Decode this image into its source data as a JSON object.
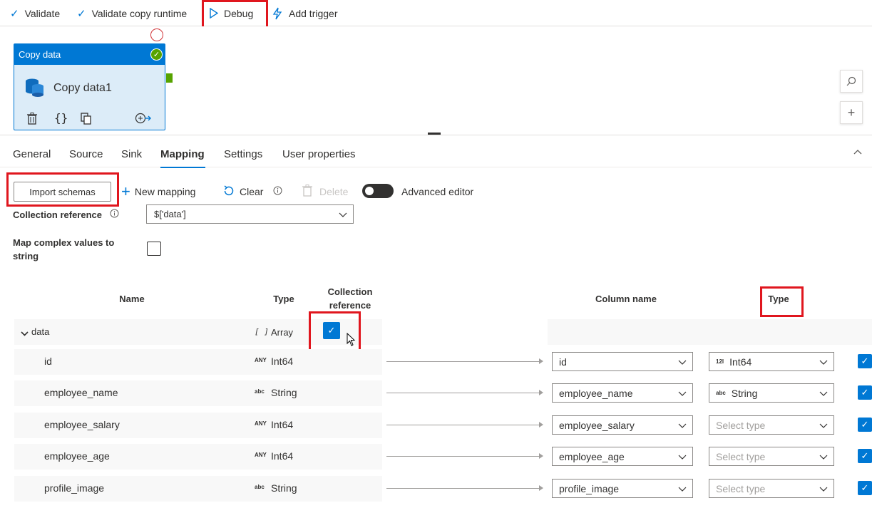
{
  "toolbar": {
    "validate": "Validate",
    "validate_copy_runtime": "Validate copy runtime",
    "debug": "Debug",
    "add_trigger": "Add trigger"
  },
  "activity": {
    "header": "Copy data",
    "name": "Copy data1",
    "status_color": "#57a300"
  },
  "tabs": [
    "General",
    "Source",
    "Sink",
    "Mapping",
    "Settings",
    "User properties"
  ],
  "active_tab": "Mapping",
  "actions": {
    "import_schemas": "Import schemas",
    "new_mapping": "New mapping",
    "clear": "Clear",
    "delete": "Delete",
    "advanced_editor": "Advanced editor"
  },
  "form": {
    "collection_reference_label": "Collection reference",
    "collection_reference_value": "$['data']",
    "map_complex_label_line1": "Map complex values to",
    "map_complex_label_line2": "string"
  },
  "table": {
    "headers": {
      "name": "Name",
      "type": "Type",
      "collection_ref_line1": "Collection",
      "collection_ref_line2": "reference",
      "column_name": "Column name",
      "sink_type": "Type"
    },
    "root": {
      "name": "data",
      "type_badge": "[ ]",
      "type": "Array"
    },
    "rows": [
      {
        "name": "id",
        "badge": "ANY",
        "type": "Int64",
        "column": "id",
        "sink_badge": "12l",
        "sink_type": "Int64"
      },
      {
        "name": "employee_name",
        "badge": "abc",
        "type": "String",
        "column": "employee_name",
        "sink_badge": "abc",
        "sink_type": "String"
      },
      {
        "name": "employee_salary",
        "badge": "ANY",
        "type": "Int64",
        "column": "employee_salary",
        "sink_badge": "",
        "sink_type": "Select type"
      },
      {
        "name": "employee_age",
        "badge": "ANY",
        "type": "Int64",
        "column": "employee_age",
        "sink_badge": "",
        "sink_type": "Select type"
      },
      {
        "name": "profile_image",
        "badge": "abc",
        "type": "String",
        "column": "profile_image",
        "sink_badge": "",
        "sink_type": "Select type"
      }
    ]
  },
  "colors": {
    "accent": "#0078d4",
    "highlight": "#e0161e"
  }
}
